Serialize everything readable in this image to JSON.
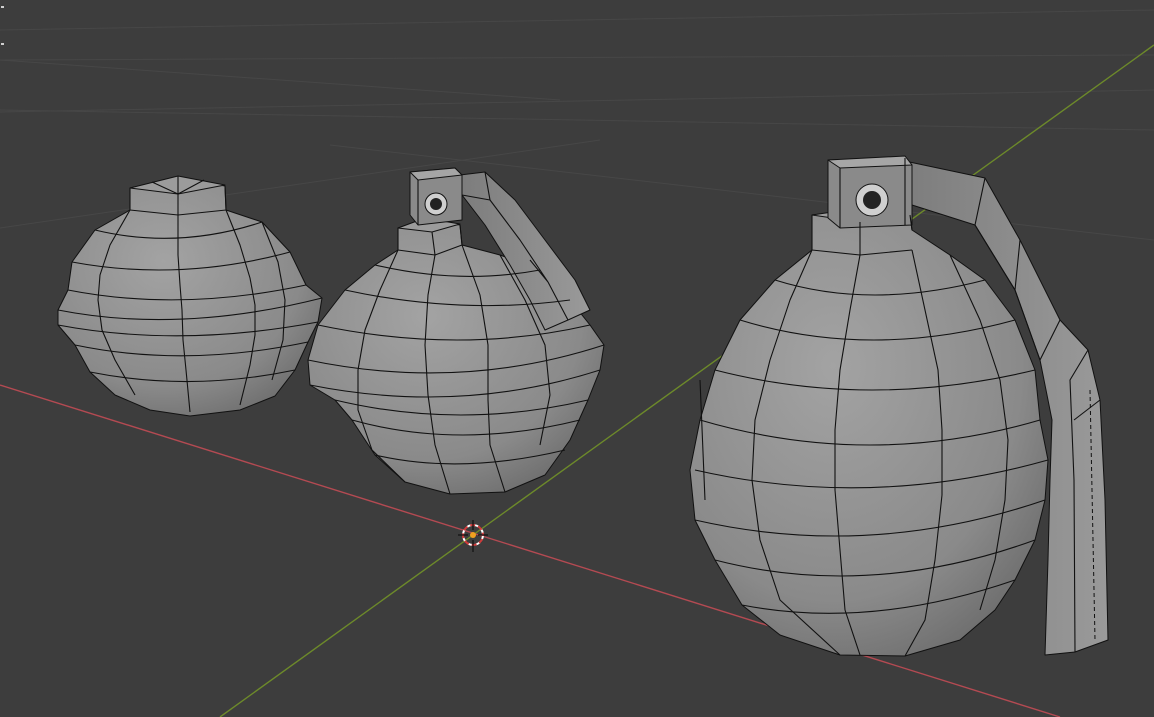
{
  "viewport": {
    "background": "#3d3d3d",
    "grid_color": "#474747",
    "x_axis_color": "#b44a52",
    "y_axis_color": "#6d8a2a",
    "mesh_fill": "#8d8d8d",
    "mesh_fill_light": "#a0a0a0",
    "mesh_fill_dark": "#6e6e6e",
    "wire_color": "#111111"
  },
  "scene": {
    "objects": [
      {
        "name": "grenade-body-plain"
      },
      {
        "name": "grenade-with-lever-small"
      },
      {
        "name": "grenade-with-lever-large"
      }
    ],
    "cursor_icon": "3d-cursor-icon"
  }
}
